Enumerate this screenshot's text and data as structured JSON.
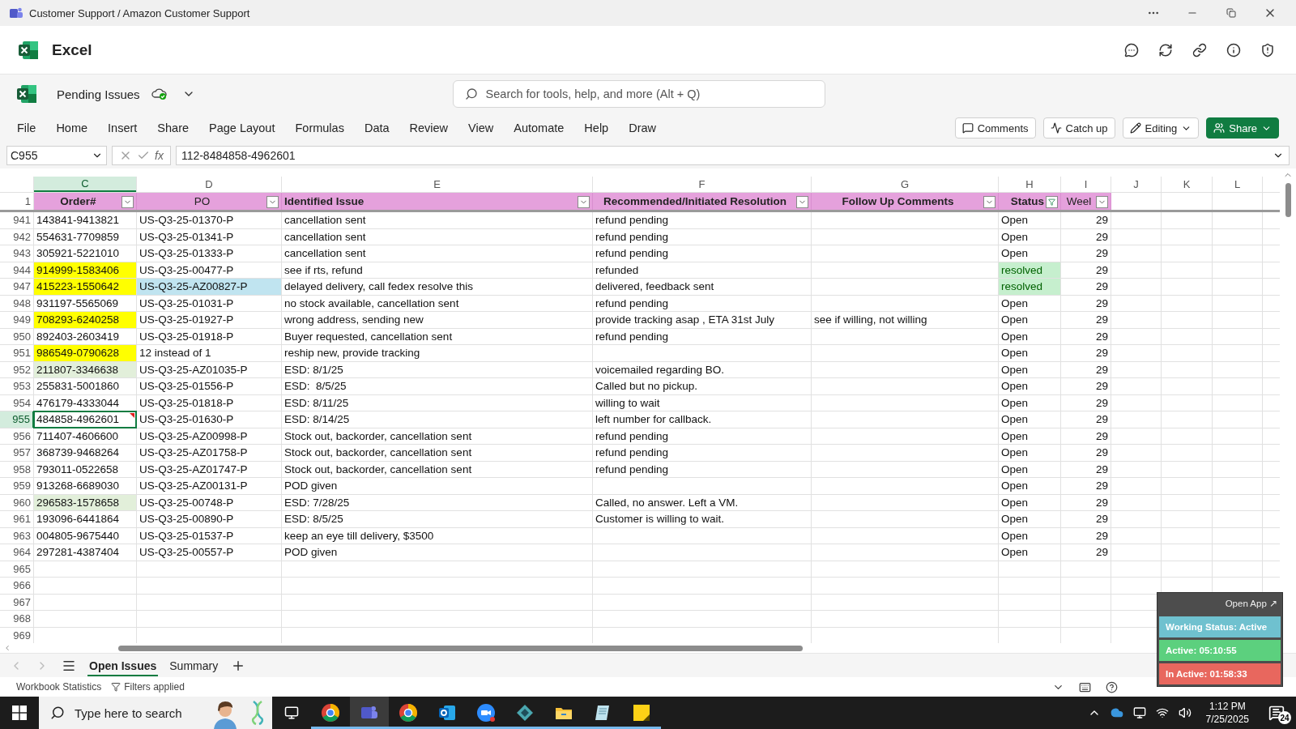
{
  "window": {
    "title": "Customer Support / Amazon Customer Support"
  },
  "app": {
    "name": "Excel"
  },
  "document": {
    "name": "Pending Issues"
  },
  "search": {
    "placeholder": "Search for tools, help, and more (Alt + Q)"
  },
  "menu": [
    "File",
    "Home",
    "Insert",
    "Share",
    "Page Layout",
    "Formulas",
    "Data",
    "Review",
    "View",
    "Automate",
    "Help",
    "Draw"
  ],
  "toolbar_buttons": [
    {
      "label": "Comments",
      "kind": "comments"
    },
    {
      "label": "Catch up",
      "kind": "catchup"
    },
    {
      "label": "Editing",
      "kind": "editing"
    },
    {
      "label": "Share",
      "kind": "share"
    }
  ],
  "formula_bar": {
    "name_box": "C955",
    "function_label": "fx",
    "value": "112-8484858-4962601"
  },
  "column_letters": [
    {
      "label": "C",
      "selected": true
    },
    {
      "label": "D",
      "selected": false
    },
    {
      "label": "E",
      "selected": false
    },
    {
      "label": "F",
      "selected": false
    },
    {
      "label": "G",
      "selected": false
    },
    {
      "label": "H",
      "selected": false
    },
    {
      "label": "I",
      "selected": false
    },
    {
      "label": "J",
      "selected": false
    },
    {
      "label": "K",
      "selected": false
    },
    {
      "label": "L",
      "selected": false
    }
  ],
  "header_row": {
    "number": "1",
    "cells": [
      {
        "label": "Order#",
        "filtered": false
      },
      {
        "label": "PO",
        "filtered": false
      },
      {
        "label": "Identified Issue",
        "filtered": false
      },
      {
        "label": "Recommended/Initiated Resolution",
        "filtered": false
      },
      {
        "label": "Follow Up Comments",
        "filtered": false
      },
      {
        "label": "Status",
        "filtered": true
      },
      {
        "label": "Weel",
        "filtered": false
      }
    ]
  },
  "rows": [
    {
      "number": "941",
      "selected": false,
      "note": false,
      "order": "143841-9413821",
      "po": "US-Q3-25-01370-P",
      "issue": "cancellation sent",
      "resolution": "refund pending",
      "status": "Open",
      "week": "29"
    },
    {
      "number": "942",
      "selected": false,
      "note": false,
      "order": "554631-7709859",
      "po": "US-Q3-25-01341-P",
      "issue": "cancellation sent",
      "resolution": "refund pending",
      "status": "Open",
      "week": "29"
    },
    {
      "number": "943",
      "selected": false,
      "note": false,
      "order": "305921-5221010",
      "po": "US-Q3-25-01333-P",
      "issue": "cancellation sent",
      "resolution": "refund pending",
      "status": "Open",
      "week": "29"
    },
    {
      "number": "944",
      "selected": false,
      "note": false,
      "order": {
        "text": "914999-1583406",
        "color": "#ffff00"
      },
      "po": "US-Q3-25-00477-P",
      "issue": "see if rts, refund",
      "resolution": "refunded",
      "status": {
        "text": "resolved",
        "color": "#c6efce"
      },
      "week": "29"
    },
    {
      "number": "947",
      "selected": false,
      "note": false,
      "order": {
        "text": "415223-1550642",
        "color": "#ffff00"
      },
      "po": {
        "text": "US-Q3-25-AZ00827-P",
        "color": "#c0e4f0"
      },
      "issue": "delayed delivery, call fedex resolve this",
      "resolution": "delivered, feedback sent",
      "status": {
        "text": "resolved",
        "color": "#c6efce"
      },
      "week": "29"
    },
    {
      "number": "948",
      "selected": false,
      "note": false,
      "order": "931197-5565069",
      "po": "US-Q3-25-01031-P",
      "issue": "no stock available, cancellation sent",
      "resolution": "refund pending",
      "status": "Open",
      "week": "29"
    },
    {
      "number": "949",
      "selected": false,
      "note": false,
      "order": {
        "text": "708293-6240258",
        "color": "#ffff00"
      },
      "po": "US-Q3-25-01927-P",
      "issue": "wrong address, sending new",
      "resolution": "provide tracking asap , ETA 31st July",
      "comment": "see if willing, not willing",
      "status": "Open",
      "week": "29"
    },
    {
      "number": "950",
      "selected": false,
      "note": false,
      "order": "892403-2603419",
      "po": "US-Q3-25-01918-P",
      "issue": "Buyer requested, cancellation sent",
      "resolution": "refund pending",
      "status": "Open",
      "week": "29"
    },
    {
      "number": "951",
      "selected": false,
      "note": false,
      "order": {
        "text": "986549-0790628",
        "color": "#ffff00"
      },
      "po": "12 instead of 1",
      "issue": "reship new, provide tracking",
      "status": "Open",
      "week": "29"
    },
    {
      "number": "952",
      "selected": false,
      "note": false,
      "order": {
        "text": "211807-3346638",
        "color": "#e2efda"
      },
      "po": "US-Q3-25-AZ01035-P",
      "issue": "ESD: 8/1/25",
      "resolution": "voicemailed regarding BO.",
      "status": "Open",
      "week": "29"
    },
    {
      "number": "953",
      "selected": false,
      "note": false,
      "order": "255831-5001860",
      "po": "US-Q3-25-01556-P",
      "issue": "ESD:  8/5/25",
      "resolution": "Called but no pickup.",
      "status": "Open",
      "week": "29"
    },
    {
      "number": "954",
      "selected": false,
      "note": false,
      "order": "476179-4333044",
      "po": "US-Q3-25-01818-P",
      "issue": "ESD: 8/11/25",
      "resolution": "willing to wait",
      "status": "Open",
      "week": "29"
    },
    {
      "number": "955",
      "selected": true,
      "note": true,
      "order": "484858-4962601",
      "po": "US-Q3-25-01630-P",
      "issue": "ESD: 8/14/25",
      "resolution": "left number for callback.",
      "status": "Open",
      "week": "29"
    },
    {
      "number": "956",
      "selected": false,
      "note": false,
      "order": "711407-4606600",
      "po": "US-Q3-25-AZ00998-P",
      "issue": "Stock out, backorder, cancellation sent",
      "resolution": "refund pending",
      "status": "Open",
      "week": "29"
    },
    {
      "number": "957",
      "selected": false,
      "note": false,
      "order": "368739-9468264",
      "po": "US-Q3-25-AZ01758-P",
      "issue": "Stock out, backorder, cancellation sent",
      "resolution": "refund pending",
      "status": "Open",
      "week": "29"
    },
    {
      "number": "958",
      "selected": false,
      "note": false,
      "order": "793011-0522658",
      "po": "US-Q3-25-AZ01747-P",
      "issue": "Stock out, backorder, cancellation sent",
      "resolution": "refund pending",
      "status": "Open",
      "week": "29"
    },
    {
      "number": "959",
      "selected": false,
      "note": false,
      "order": "913268-6689030",
      "po": "US-Q3-25-AZ00131-P",
      "issue": "POD given",
      "status": "Open",
      "week": "29"
    },
    {
      "number": "960",
      "selected": false,
      "note": false,
      "order": {
        "text": "296583-1578658",
        "color": "#e2efda"
      },
      "po": "US-Q3-25-00748-P",
      "issue": "ESD: 7/28/25",
      "resolution": "Called, no answer. Left a VM.",
      "status": "Open",
      "week": "29"
    },
    {
      "number": "961",
      "selected": false,
      "note": false,
      "order": "193096-6441864",
      "po": "US-Q3-25-00890-P",
      "issue": "ESD: 8/5/25",
      "resolution": "Customer is willing to wait.",
      "status": "Open",
      "week": "29"
    },
    {
      "number": "963",
      "selected": false,
      "note": false,
      "order": "004805-9675440",
      "po": "US-Q3-25-01537-P",
      "issue": "keep an eye till delivery, $3500",
      "status": "Open",
      "week": "29"
    },
    {
      "number": "964",
      "selected": false,
      "note": false,
      "order": "297281-4387404",
      "po": "US-Q3-25-00557-P",
      "issue": "POD given",
      "status": "Open",
      "week": "29"
    },
    {
      "number": "965",
      "selected": false,
      "note": false
    },
    {
      "number": "966",
      "selected": false,
      "note": false
    },
    {
      "number": "967",
      "selected": false,
      "note": false
    },
    {
      "number": "968",
      "selected": false,
      "note": false
    },
    {
      "number": "969",
      "selected": false,
      "note": false
    }
  ],
  "sheet_tabs": [
    {
      "label": "Open Issues",
      "selected": true
    },
    {
      "label": "Summary",
      "selected": false
    }
  ],
  "status_bar": {
    "statistics": "Workbook Statistics",
    "filters": "Filters applied"
  },
  "tracker": {
    "link": "Open App ↗",
    "status": "Working Status: Active",
    "active": "Active: 05:10:55",
    "inactive": "In Active: 01:58:33"
  },
  "taskbar": {
    "search_placeholder": "Type here to search",
    "apps": [
      {
        "kind": "chrome",
        "selected": false
      },
      {
        "kind": "teams",
        "selected": true
      },
      {
        "kind": "chrome",
        "selected": false
      },
      {
        "kind": "outlook",
        "selected": false
      },
      {
        "kind": "zoom",
        "selected": false
      },
      {
        "kind": "diamond",
        "selected": false
      },
      {
        "kind": "folder",
        "selected": false
      },
      {
        "kind": "notes",
        "selected": false
      },
      {
        "kind": "sticky",
        "selected": false
      }
    ],
    "time": "1:12 PM",
    "date": "7/25/2025",
    "notifications": "24"
  }
}
